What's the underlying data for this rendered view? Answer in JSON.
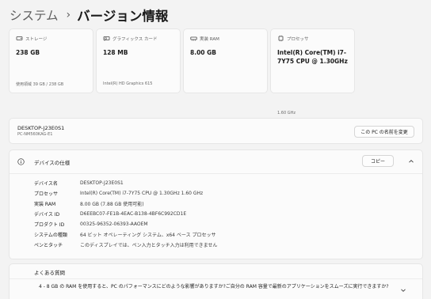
{
  "breadcrumb": {
    "parent": "システム",
    "separator": "›",
    "current": "バージョン情報"
  },
  "cards": [
    {
      "icon": "storage-icon",
      "title": "ストレージ",
      "value": "238 GB",
      "sub": "使用領域 39 GB / 238 GB"
    },
    {
      "icon": "graphics-card-icon",
      "title": "グラフィックス カード",
      "value": "128 MB",
      "sub": "Intel(R) HD Graphics 615"
    },
    {
      "icon": "ram-icon",
      "title": "実装 RAM",
      "value": "8.00 GB",
      "sub": ""
    },
    {
      "icon": "processor-icon",
      "title": "プロセッサ",
      "value": "Intel(R) Core(TM) i7-7Y75 CPU @ 1.30GHz",
      "sub": "1.60 GHz"
    }
  ],
  "device": {
    "name": "DESKTOP-J23E0S1",
    "model": "PC-NM560KAG-E1",
    "rename_label": "この PC の名前を変更"
  },
  "specs": {
    "title": "デバイスの仕様",
    "copy_label": "コピー",
    "rows": [
      {
        "label": "デバイス名",
        "value": "DESKTOP-J23E0S1"
      },
      {
        "label": "プロセッサ",
        "value": "Intel(R) Core(TM) i7-7Y75 CPU @ 1.30GHz   1.60 GHz"
      },
      {
        "label": "実装 RAM",
        "value": "8.00 GB (7.88 GB 使用可能)"
      },
      {
        "label": "デバイス ID",
        "value": "D6EEBC07-FE1B-4EAC-B138-4BF6C992CD1E"
      },
      {
        "label": "プロダクト ID",
        "value": "00325-96352-06393-AAOEM"
      },
      {
        "label": "システムの種類",
        "value": "64 ビット オペレーティング システム、x64 ベース プロセッサ"
      },
      {
        "label": "ペンとタッチ",
        "value": "このディスプレイでは、ペン入力とタッチ入力は利用できません"
      }
    ]
  },
  "faq": {
    "title": "よくある質問",
    "question": "4 - 8 GB の RAM を使用すると、PC のパフォーマンスにどのような影響がありますか?ご自分の RAM 容量で最新のアプリケーションをスムーズに実行できますか?"
  }
}
